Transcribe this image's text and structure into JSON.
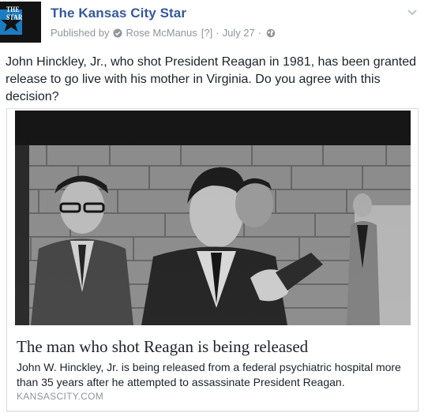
{
  "post": {
    "page_name": "The Kansas City Star",
    "logo_text": "THE STAR",
    "published_by_prefix": "Published by",
    "author": "Rose McManus",
    "help_marker": "[?]",
    "separator": "·",
    "date": "July 27",
    "message": "John Hinckley, Jr., who shot President Reagan in 1981, has been granted release to go live with his mother in Virginia. Do you agree with this decision?",
    "icons": {
      "author": "author-badge-icon",
      "audience": "globe-icon",
      "menu": "chevron-down-icon"
    }
  },
  "link_card": {
    "title": "The man who shot Reagan is being released",
    "description": "John W. Hinckley, Jr. is being released from a federal psychiatric hospital more than 35 years after he attempted to assassinate President Reagan.",
    "domain": "KANSASCITY.COM"
  },
  "colors": {
    "link_blue": "#365899",
    "meta_gray": "#90949c",
    "text": "#1d2129",
    "logo_blue": "#1b7cc1"
  }
}
